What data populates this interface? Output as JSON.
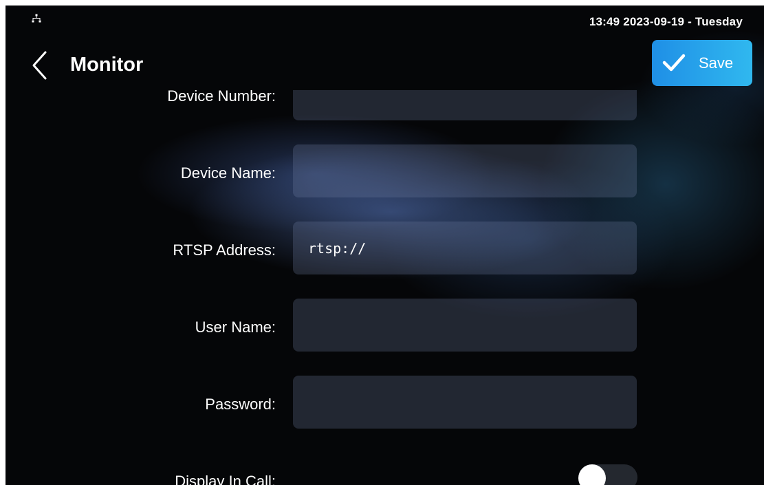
{
  "status_bar": {
    "network_icon": "network-icon",
    "datetime": "13:49  2023-09-19 - Tuesday"
  },
  "header": {
    "back_icon": "chevron-left-icon",
    "title": "Monitor",
    "save_button": {
      "icon": "checkmark-icon",
      "label": "Save"
    }
  },
  "form": {
    "fields": [
      {
        "label": "Device Number:",
        "value": ""
      },
      {
        "label": "Device Name:",
        "value": ""
      },
      {
        "label": "RTSP Address:",
        "value": "rtsp://"
      },
      {
        "label": "User Name:",
        "value": ""
      },
      {
        "label": "Password:",
        "value": ""
      }
    ],
    "display_in_call": {
      "label": "Display In Call:",
      "enabled": false
    }
  },
  "colors": {
    "accent_start": "#1f8fe6",
    "accent_end": "#30b8ef",
    "background": "#050608"
  }
}
